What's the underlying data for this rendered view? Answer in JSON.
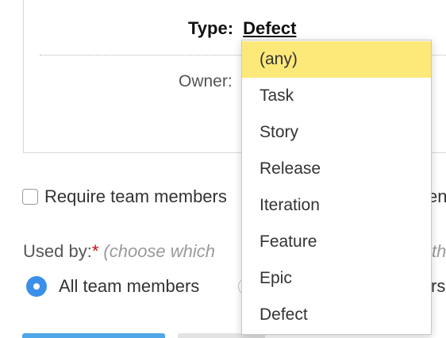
{
  "panel": {
    "type_label": "Type:",
    "type_value": "Defect",
    "owner_label": "Owner:"
  },
  "require": {
    "label": "Require team members",
    "trail": "en"
  },
  "used_by": {
    "label": "Used by:",
    "required_marker": "*",
    "hint": "(choose which",
    "hint_trail": "th"
  },
  "radios": {
    "all_label": "All team members",
    "second_trail": "rs"
  },
  "dropdown": {
    "options": [
      "(any)",
      "Task",
      "Story",
      "Release",
      "Iteration",
      "Feature",
      "Epic",
      "Defect"
    ],
    "highlighted": "(any)"
  },
  "colors": {
    "highlight": "#fde87a",
    "radio_selected": "#3a8fe8",
    "required": "#d0021b",
    "primary_button": "#4fa6e8"
  }
}
